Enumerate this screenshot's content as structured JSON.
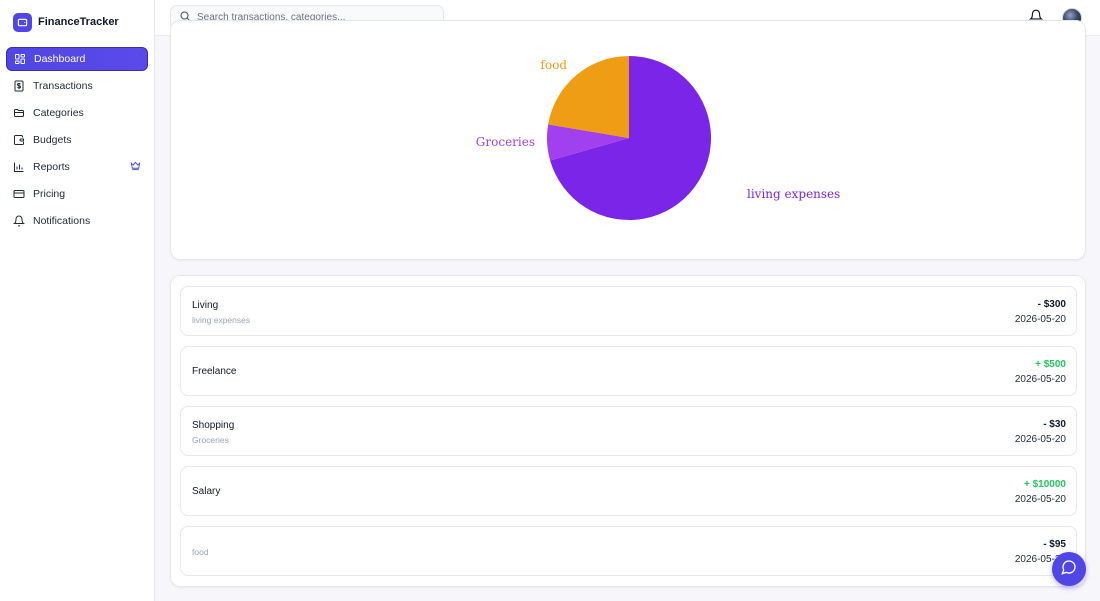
{
  "app": {
    "name": "FinanceTracker"
  },
  "sidebar": {
    "items": [
      {
        "label": "Dashboard",
        "icon": "dashboard-icon",
        "active": true
      },
      {
        "label": "Transactions",
        "icon": "receipt-icon"
      },
      {
        "label": "Categories",
        "icon": "folder-icon"
      },
      {
        "label": "Budgets",
        "icon": "wallet-icon"
      },
      {
        "label": "Reports",
        "icon": "bar-chart-icon",
        "badge": "crown-icon"
      },
      {
        "label": "Pricing",
        "icon": "credit-card-icon"
      },
      {
        "label": "Notifications",
        "icon": "bell-icon"
      }
    ]
  },
  "topbar": {
    "search_placeholder": "Search transactions, categories..."
  },
  "chart_data": {
    "type": "pie",
    "slices": [
      {
        "label": "living expenses",
        "value": 300,
        "color": "#7a25e8"
      },
      {
        "label": "Groceries",
        "value": 30,
        "color": "#a040ee"
      },
      {
        "label": "food",
        "value": 95,
        "color": "#ef9d15"
      }
    ]
  },
  "transactions": [
    {
      "title": "Living",
      "category": "living expenses",
      "amount": "- $300",
      "date": "2026-05-20",
      "type": "expense"
    },
    {
      "title": "Freelance",
      "category": "",
      "amount": "+ $500",
      "date": "2026-05-20",
      "type": "income"
    },
    {
      "title": "Shopping",
      "category": "Groceries",
      "amount": "- $30",
      "date": "2026-05-20",
      "type": "expense"
    },
    {
      "title": "Salary",
      "category": "",
      "amount": "+ $10000",
      "date": "2026-05-20",
      "type": "income"
    },
    {
      "title": "",
      "category": "food",
      "amount": "- $95",
      "date": "2026-05-20",
      "type": "expense"
    }
  ],
  "colors": {
    "accent": "#4f46e5",
    "income": "#22c55e",
    "expense": "#111827"
  }
}
